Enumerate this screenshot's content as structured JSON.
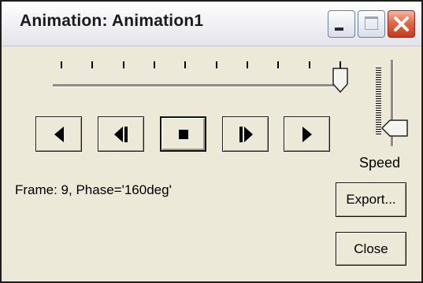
{
  "window": {
    "title": "Animation: Animation1"
  },
  "icons": {
    "minimize": "minimize-icon",
    "maximize": "maximize-icon",
    "close": "close-icon",
    "play_backward": "play-backward-icon",
    "step_backward": "step-backward-icon",
    "stop": "stop-icon",
    "step_forward": "step-forward-icon",
    "play_forward": "play-forward-icon"
  },
  "frame_slider": {
    "tick_count": 10,
    "value_fraction": 1.0
  },
  "speed_slider": {
    "label": "Speed",
    "value_fraction": 0.12
  },
  "status": {
    "frame_text": "Frame: 9, Phase='160deg'"
  },
  "buttons": {
    "export_label": "Export...",
    "close_label": "Close"
  },
  "colors": {
    "close_button": "#d0432a",
    "dialog_face": "#ece9d8"
  }
}
